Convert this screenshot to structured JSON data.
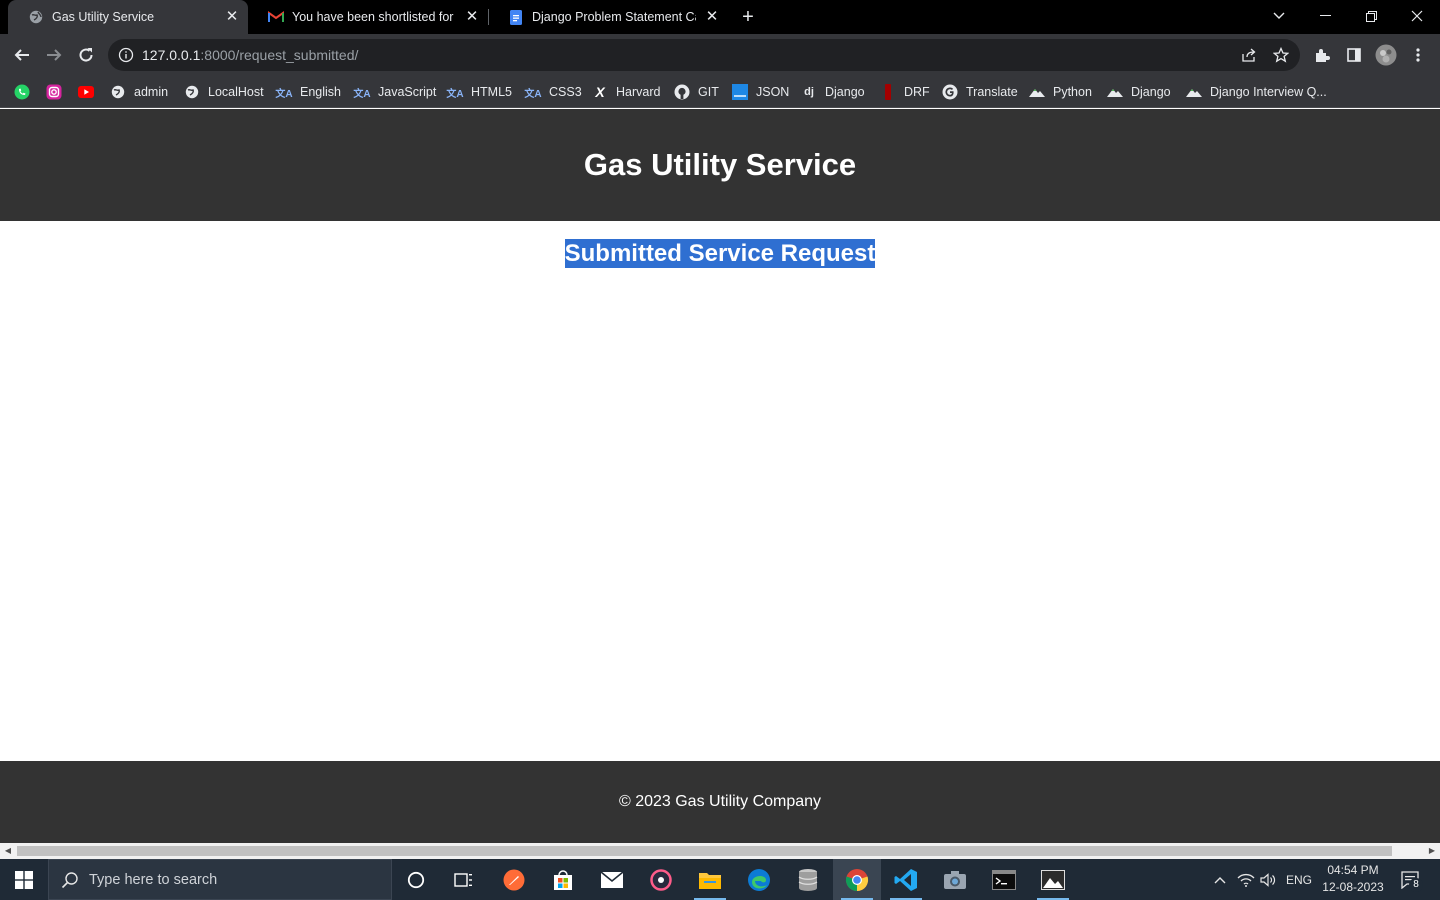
{
  "browser": {
    "tabs": [
      {
        "title": "Gas Utility Service",
        "active": true
      },
      {
        "title": "You have been shortlisted for the",
        "active": false
      },
      {
        "title": "Django Problem Statement Case",
        "active": false
      }
    ],
    "url_host": "127.0.0.1",
    "url_rest": ":8000/request_submitted/",
    "bookmarks": [
      {
        "label": "",
        "icon": "whatsapp-icon"
      },
      {
        "label": "",
        "icon": "instagram-icon"
      },
      {
        "label": "",
        "icon": "youtube-icon"
      },
      {
        "label": "admin",
        "icon": "globe-icon"
      },
      {
        "label": "LocalHost",
        "icon": "globe-icon"
      },
      {
        "label": "English",
        "icon": "translate-icon"
      },
      {
        "label": "JavaScript",
        "icon": "translate-icon"
      },
      {
        "label": "HTML5",
        "icon": "translate-icon"
      },
      {
        "label": "CSS3",
        "icon": "translate-icon"
      },
      {
        "label": "Harvard",
        "icon": "x-logo-icon"
      },
      {
        "label": "GIT",
        "icon": "github-icon"
      },
      {
        "label": "JSON",
        "icon": "json-icon"
      },
      {
        "label": "Django",
        "icon": "dj-icon"
      },
      {
        "label": "DRF",
        "icon": "drf-icon"
      },
      {
        "label": "Translate",
        "icon": "google-icon"
      },
      {
        "label": "Python",
        "icon": "mountain-icon"
      },
      {
        "label": "Django",
        "icon": "mountain-icon"
      },
      {
        "label": "Django Interview Q...",
        "icon": "mountain-icon"
      }
    ]
  },
  "site": {
    "header_title": "Gas Utility Service",
    "page_heading": "Submitted Service Request",
    "footer_text": "© 2023 Gas Utility Company"
  },
  "taskbar": {
    "search_placeholder": "Type here to search",
    "language": "ENG",
    "time": "04:54 PM",
    "date": "12-08-2023",
    "notification_count": "8"
  },
  "colors": {
    "site_header_bg": "#333333",
    "selection_highlight": "#2f6fd1",
    "browser_chrome": "#35363a"
  }
}
